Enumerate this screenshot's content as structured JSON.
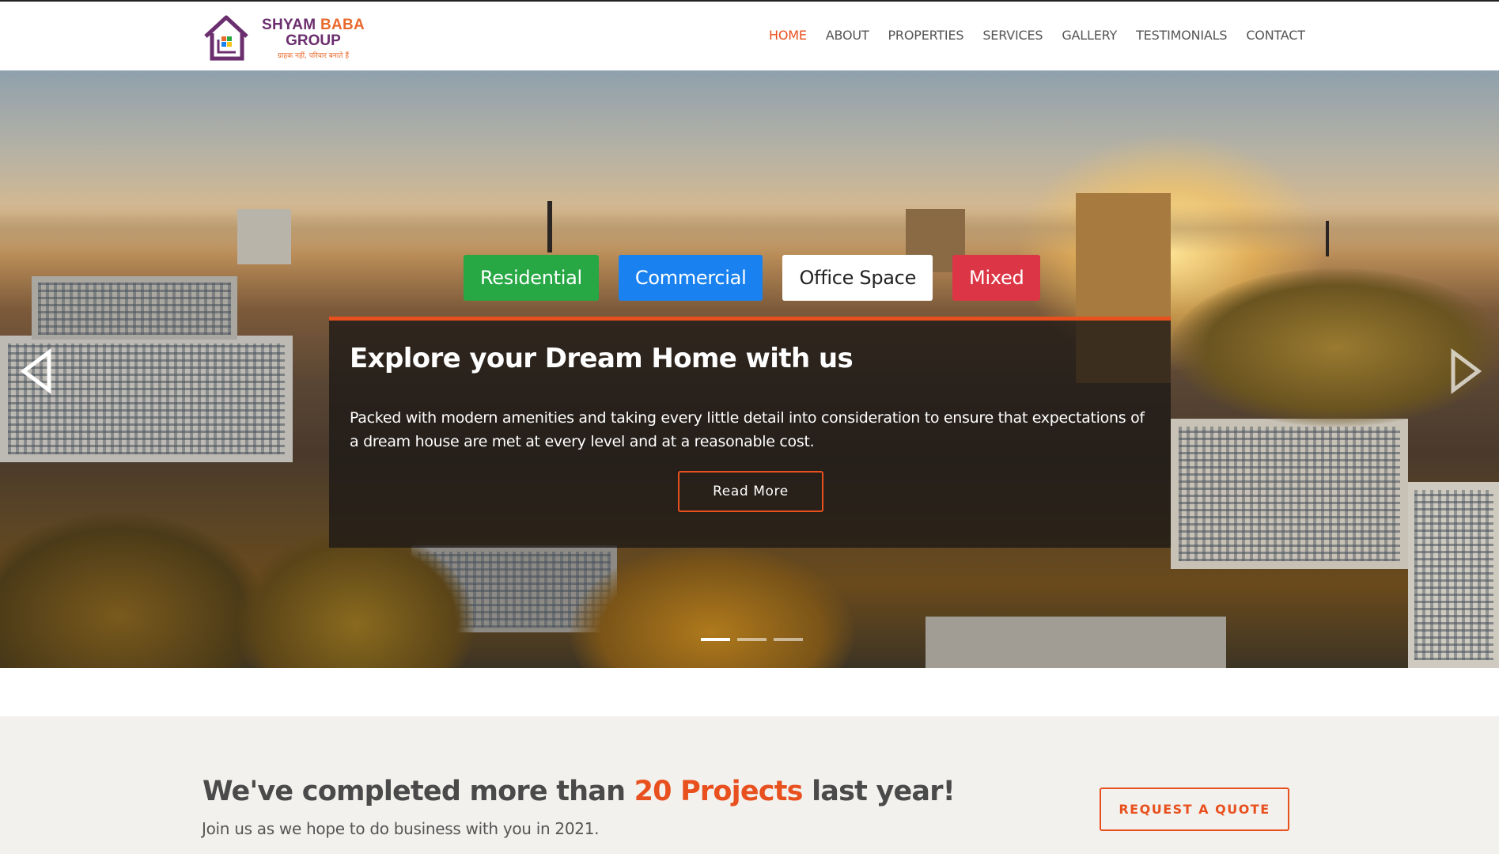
{
  "brand": {
    "name_line1_part1": "SHYAM",
    "name_line1_part2": "BABA",
    "name_line2": "GROUP",
    "tagline": "ग्राहक नहीं, परिवार बनाते हैं",
    "colors": {
      "primary": "#6b2e6e",
      "accent": "#e8692c"
    }
  },
  "nav": {
    "items": [
      {
        "label": "HOME",
        "active": true
      },
      {
        "label": "ABOUT",
        "active": false
      },
      {
        "label": "PROPERTIES",
        "active": false
      },
      {
        "label": "SERVICES",
        "active": false
      },
      {
        "label": "GALLERY",
        "active": false
      },
      {
        "label": "TESTIMONIALS",
        "active": false
      },
      {
        "label": "CONTACT",
        "active": false
      }
    ],
    "active_color": "#e8501e"
  },
  "hero": {
    "filters": [
      {
        "label": "Residential",
        "color": "#28a745"
      },
      {
        "label": "Commercial",
        "color": "#1a82f0"
      },
      {
        "label": "Office Space",
        "color": "#ffffff"
      },
      {
        "label": "Mixed",
        "color": "#dc3545"
      }
    ],
    "caption": {
      "title": "Explore your Dream Home with us",
      "text": "Packed with modern amenities and taking every little detail into consideration to ensure that expectations of a dream house are met at every level and at a reasonable cost.",
      "button": "Read More"
    },
    "prev_icon": "chevron-left-icon",
    "next_icon": "chevron-right-icon",
    "slides": {
      "count": 3,
      "active": 1
    }
  },
  "cta": {
    "title_before": "We've completed more than",
    "title_highlight": "20 Projects",
    "title_after": "last year!",
    "subtitle": "Join us as we hope to do business with you in 2021.",
    "button": "REQUEST A QUOTE",
    "accent": "#e8501e"
  }
}
